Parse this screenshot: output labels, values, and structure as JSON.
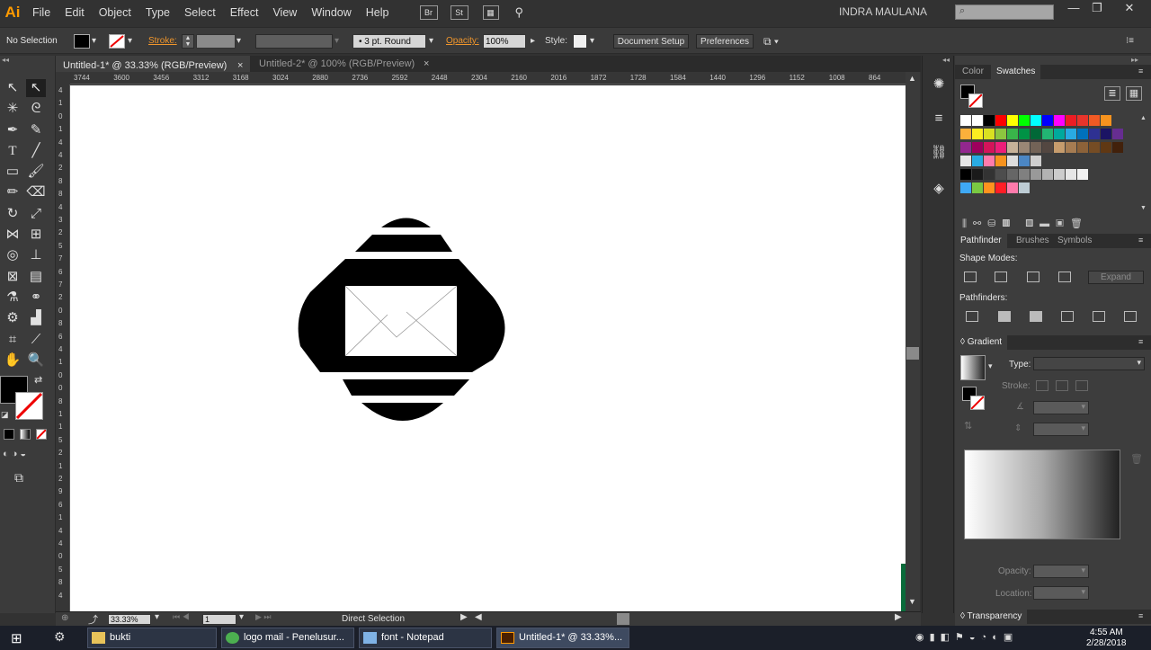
{
  "app": {
    "logo": "Ai",
    "user": "INDRA MAULANA"
  },
  "menu": [
    "File",
    "Edit",
    "Object",
    "Type",
    "Select",
    "Effect",
    "View",
    "Window",
    "Help"
  ],
  "bridge_buttons": [
    "Br",
    "St"
  ],
  "control": {
    "selection": "No Selection",
    "stroke_label": "Stroke:",
    "stroke_profile": "3 pt. Round",
    "opacity_label": "Opacity:",
    "opacity_value": "100%",
    "style_label": "Style:",
    "document_setup": "Document Setup",
    "preferences": "Preferences"
  },
  "tabs": [
    {
      "label": "Untitled-1* @ 33.33% (RGB/Preview)",
      "active": true
    },
    {
      "label": "Untitled-2* @ 100% (RGB/Preview)",
      "active": false
    }
  ],
  "ruler_h": [
    "3744",
    "3600",
    "3456",
    "3312",
    "3168",
    "3024",
    "2880",
    "2736",
    "2592",
    "2448",
    "2304",
    "2160",
    "2016",
    "1872",
    "1728",
    "1584",
    "1440",
    "1296",
    "1152",
    "1008",
    "864"
  ],
  "ruler_v": [
    "4",
    "1",
    "0",
    "1",
    "4",
    "4",
    "2",
    "8",
    "8",
    "4",
    "3",
    "2",
    "5",
    "7",
    "6",
    "7",
    "2",
    "0",
    "8",
    "6",
    "4",
    "1",
    "0",
    "0",
    "8",
    "1",
    "1",
    "5",
    "2",
    "1",
    "2",
    "9",
    "6",
    "1",
    "4",
    "4",
    "0",
    "5",
    "8",
    "4"
  ],
  "status": {
    "zoom": "33.33%",
    "artboard": "1",
    "tool": "Direct Selection"
  },
  "panels": {
    "swatch_tabs": [
      "Color",
      "Swatches"
    ],
    "pathfinder_tabs": [
      "Pathfinder",
      "Brushes",
      "Symbols"
    ],
    "shape_modes": "Shape Modes:",
    "expand": "Expand",
    "pathfinders": "Pathfinders:",
    "gradient": "Gradient",
    "type_label": "Type:",
    "stroke_label": "Stroke:",
    "opacity_label": "Opacity:",
    "location_label": "Location:",
    "transparency": "Transparency"
  },
  "swatch_rows": [
    [
      "#ffffff",
      "#ffffff",
      "#000000",
      "#ff0000",
      "#ffff00",
      "#00ff00",
      "#00ffff",
      "#0000ff",
      "#ff00ff",
      "#ed1c24",
      "#e8342b",
      "#f15a24",
      "#f7931e"
    ],
    [
      "#fbb03b",
      "#fcee21",
      "#d9e021",
      "#8cc63f",
      "#39b54a",
      "#009245",
      "#006837",
      "#22b573",
      "#00a99d",
      "#29abe2",
      "#0071bc",
      "#2e3192",
      "#1b1464",
      "#662d91"
    ],
    [
      "#93278f",
      "#9e005d",
      "#d4145a",
      "#ed1e79",
      "#c7b299",
      "#998675",
      "#736357",
      "#534741",
      "#c69c6d",
      "#a67c52",
      "#8c6239",
      "#754c24",
      "#603813",
      "#42210b"
    ],
    [
      "#e6e6e6",
      "#29abe2",
      "#ff7bac",
      "#f7931e",
      "#dddddd",
      "#4b86c4",
      "#cfcfcf"
    ],
    [
      "#000000",
      "#1a1a1a",
      "#333333",
      "#4d4d4d",
      "#666666",
      "#808080",
      "#999999",
      "#b3b3b3",
      "#cccccc",
      "#e6e6e6",
      "#f2f2f2"
    ],
    [
      "#3fa9f5",
      "#7ac943",
      "#ff931e",
      "#ff1d25",
      "#ff7bac",
      "#bdccd4"
    ]
  ],
  "taskbar": [
    {
      "label": "bukti",
      "color": "#e8c35a"
    },
    {
      "label": "logo mail - Penelusur...",
      "color": "#4caf50"
    },
    {
      "label": "font - Notepad",
      "color": "#7fb2e5"
    },
    {
      "label": "Untitled-1* @ 33.33%...",
      "color": "#ff9a00"
    }
  ],
  "clock": {
    "time": "4:55 AM",
    "date": "2/28/2018"
  }
}
